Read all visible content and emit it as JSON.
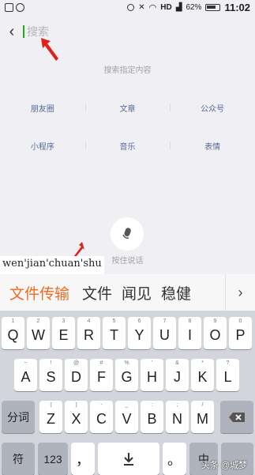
{
  "status_bar": {
    "network": "HD",
    "battery": "62%",
    "time": "11:02"
  },
  "search": {
    "placeholder": "搜索",
    "value": ""
  },
  "hint": "搜索指定内容",
  "categories": [
    [
      "朋友圈",
      "文章",
      "公众号"
    ],
    [
      "小程序",
      "音乐",
      "表情"
    ]
  ],
  "voice_label": "按住说话",
  "pinyin": "wen'jian'chuan'shu",
  "candidates": [
    "文件传输",
    "文件",
    "闻见",
    "稳健"
  ],
  "keyboard": {
    "row1": [
      [
        "Q",
        "1"
      ],
      [
        "W",
        "2"
      ],
      [
        "E",
        "3"
      ],
      [
        "R",
        "4"
      ],
      [
        "T",
        "5"
      ],
      [
        "Y",
        "6"
      ],
      [
        "U",
        "7"
      ],
      [
        "I",
        "8"
      ],
      [
        "O",
        "9"
      ],
      [
        "P",
        "0"
      ]
    ],
    "row2": [
      [
        "A",
        "~"
      ],
      [
        "S",
        "!"
      ],
      [
        "D",
        "@"
      ],
      [
        "F",
        "#"
      ],
      [
        "G",
        "%"
      ],
      [
        "H",
        "'"
      ],
      [
        "J",
        "&"
      ],
      [
        "K",
        "*"
      ],
      [
        "L",
        "?"
      ]
    ],
    "row3": [
      [
        "Z",
        "("
      ],
      [
        "X",
        ")"
      ],
      [
        "C",
        "-"
      ],
      [
        "V",
        "_"
      ],
      [
        "B",
        ":"
      ],
      [
        "N",
        ";"
      ],
      [
        "M",
        "/"
      ]
    ],
    "fenci": "分词",
    "symbol": "符",
    "num": "123",
    "comma": "，",
    "period": "。",
    "lang": "中",
    "space_label": ""
  },
  "watermark": "头条 @城梦"
}
